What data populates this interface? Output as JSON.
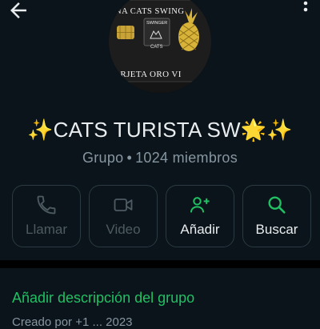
{
  "header": {
    "back_icon": "arrow-left-icon",
    "menu_icon": "more-vert-icon"
  },
  "avatar": {
    "top_text": "NA CATS SWING",
    "card_title": "SWINGER",
    "card_subtitle": "CATS",
    "bottom_text": "ARJETA ORO VI"
  },
  "group": {
    "name": "✨CATS TURISTA SW🌟✨",
    "type": "Grupo",
    "separator": "•",
    "members": "1024 miembros"
  },
  "actions": [
    {
      "label": "Llamar",
      "icon": "phone-icon",
      "enabled": false
    },
    {
      "label": "Video",
      "icon": "video-camera-icon",
      "enabled": false
    },
    {
      "label": "Añadir",
      "icon": "add-person-icon",
      "enabled": true
    },
    {
      "label": "Buscar",
      "icon": "search-icon",
      "enabled": true
    }
  ],
  "description": {
    "add_label": "Añadir descripción del grupo",
    "created_partial": "Creado por +1 ... 2023"
  },
  "colors": {
    "background": "#0b141a",
    "accent_green": "#21c063",
    "text_primary": "#e9edef",
    "text_secondary": "#8696a0",
    "disabled": "#4d5a62",
    "border": "#2a3942"
  }
}
